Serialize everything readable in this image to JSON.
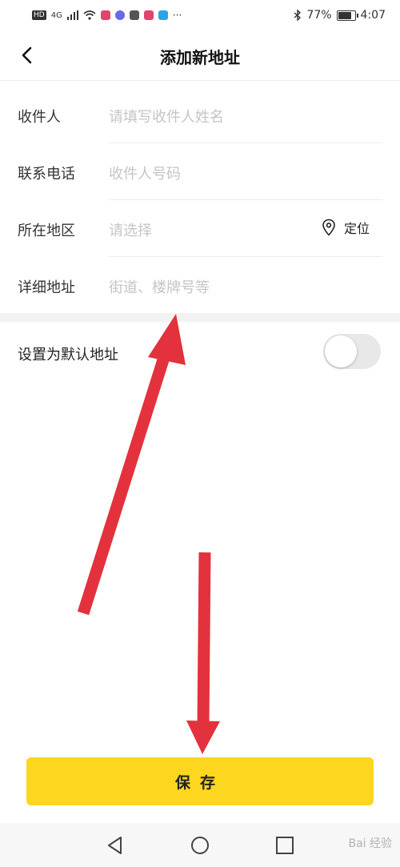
{
  "status_bar": {
    "network": "4G",
    "hd_badge": "HD",
    "battery": "77%",
    "battery_level": 0.77,
    "time": "4:07"
  },
  "header": {
    "title": "添加新地址"
  },
  "form": {
    "recipient": {
      "label": "收件人",
      "placeholder": "请填写收件人姓名"
    },
    "phone": {
      "label": "联系电话",
      "placeholder": "收件人号码"
    },
    "region": {
      "label": "所在地区",
      "placeholder": "请选择",
      "locate_label": "定位"
    },
    "address": {
      "label": "详细地址",
      "placeholder": "街道、楼牌号等"
    }
  },
  "default_address": {
    "label": "设置为默认地址",
    "enabled": false
  },
  "save_button": {
    "label": "保存"
  },
  "watermark": "Bai 经验",
  "colors": {
    "accent": "#fdd61f",
    "annotation_arrow": "#e3323d"
  }
}
